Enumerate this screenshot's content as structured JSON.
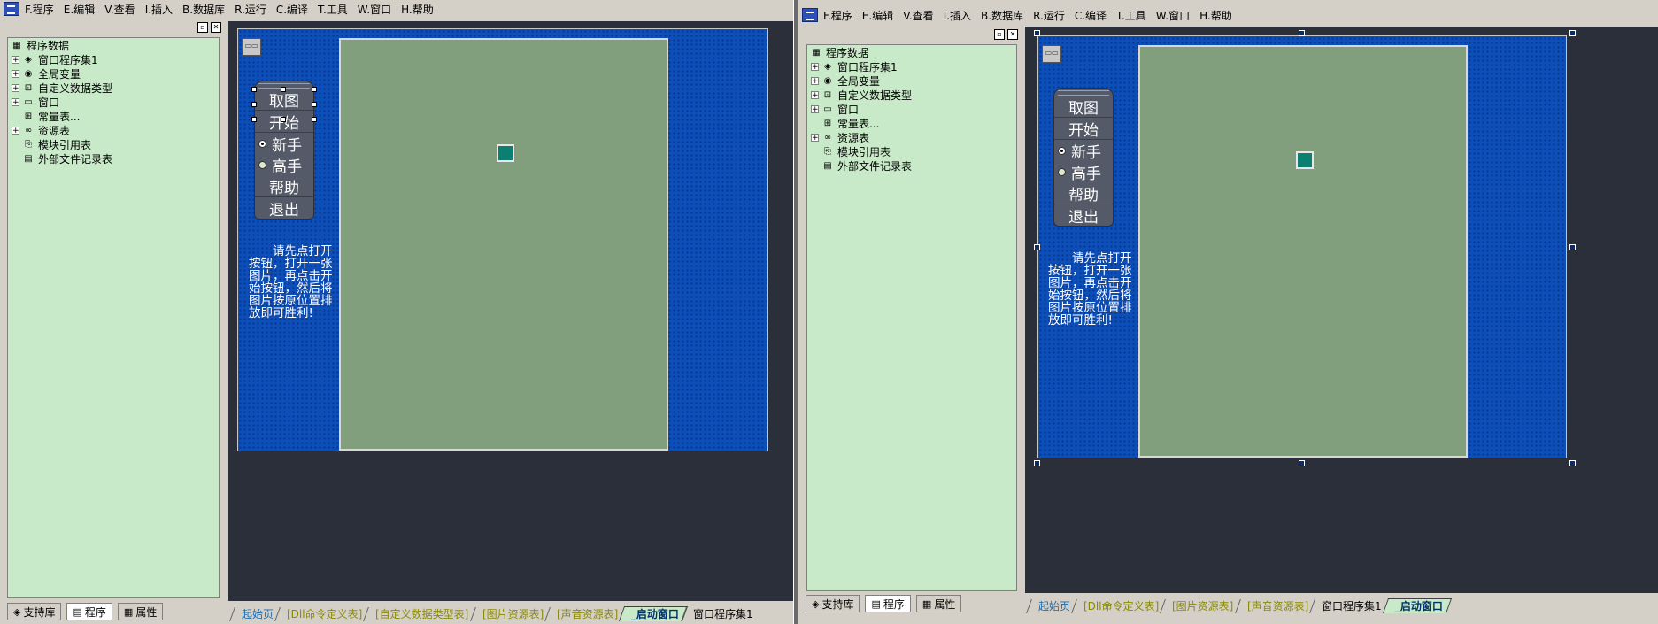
{
  "menu": [
    "F.程序",
    "E.编辑",
    "V.查看",
    "I.插入",
    "B.数据库",
    "R.运行",
    "C.编译",
    "T.工具",
    "W.窗口",
    "H.帮助"
  ],
  "tree": {
    "root": "程序数据",
    "items": [
      {
        "label": "窗口程序集1",
        "icon": "module-icon",
        "expandable": true
      },
      {
        "label": "全局变量",
        "icon": "variable-icon",
        "expandable": true
      },
      {
        "label": "自定义数据类型",
        "icon": "datatype-icon",
        "expandable": true
      },
      {
        "label": "窗口",
        "icon": "window-icon",
        "expandable": true
      },
      {
        "label": "常量表...",
        "icon": "constant-icon",
        "expandable": false
      },
      {
        "label": "资源表",
        "icon": "resource-icon",
        "expandable": true
      },
      {
        "label": "模块引用表",
        "icon": "module-ref-icon",
        "expandable": false
      },
      {
        "label": "外部文件记录表",
        "icon": "file-record-icon",
        "expandable": false
      }
    ]
  },
  "lower_tabs": [
    "支持库",
    "程序",
    "属性"
  ],
  "form": {
    "buttons": [
      "取图",
      "开始"
    ],
    "radio_novice": "新手",
    "radio_expert": "高手",
    "buttons2": [
      "帮助",
      "退出"
    ],
    "hint": "请先点打开按钮，打开一张图片，再点击开始按钮，然后将图片按原位置排放即可胜利!"
  },
  "doc_tabs_left": [
    "起始页",
    "[Dll命令定义表]",
    "[自定义数据类型表]",
    "[图片资源表]",
    "[声音资源表]",
    "_启动窗口",
    "窗口程序集1"
  ],
  "doc_tabs_right": [
    "起始页",
    "[Dll命令定义表]",
    "[图片资源表]",
    "[声音资源表]",
    "窗口程序集1",
    "_启动窗口"
  ],
  "colors": {
    "tree_bg": "#c8eac8",
    "form_bg": "#0d4fb8",
    "board_bg": "#819e7d",
    "editor_bg": "#2b2f3a",
    "piece": "#0b8070"
  }
}
